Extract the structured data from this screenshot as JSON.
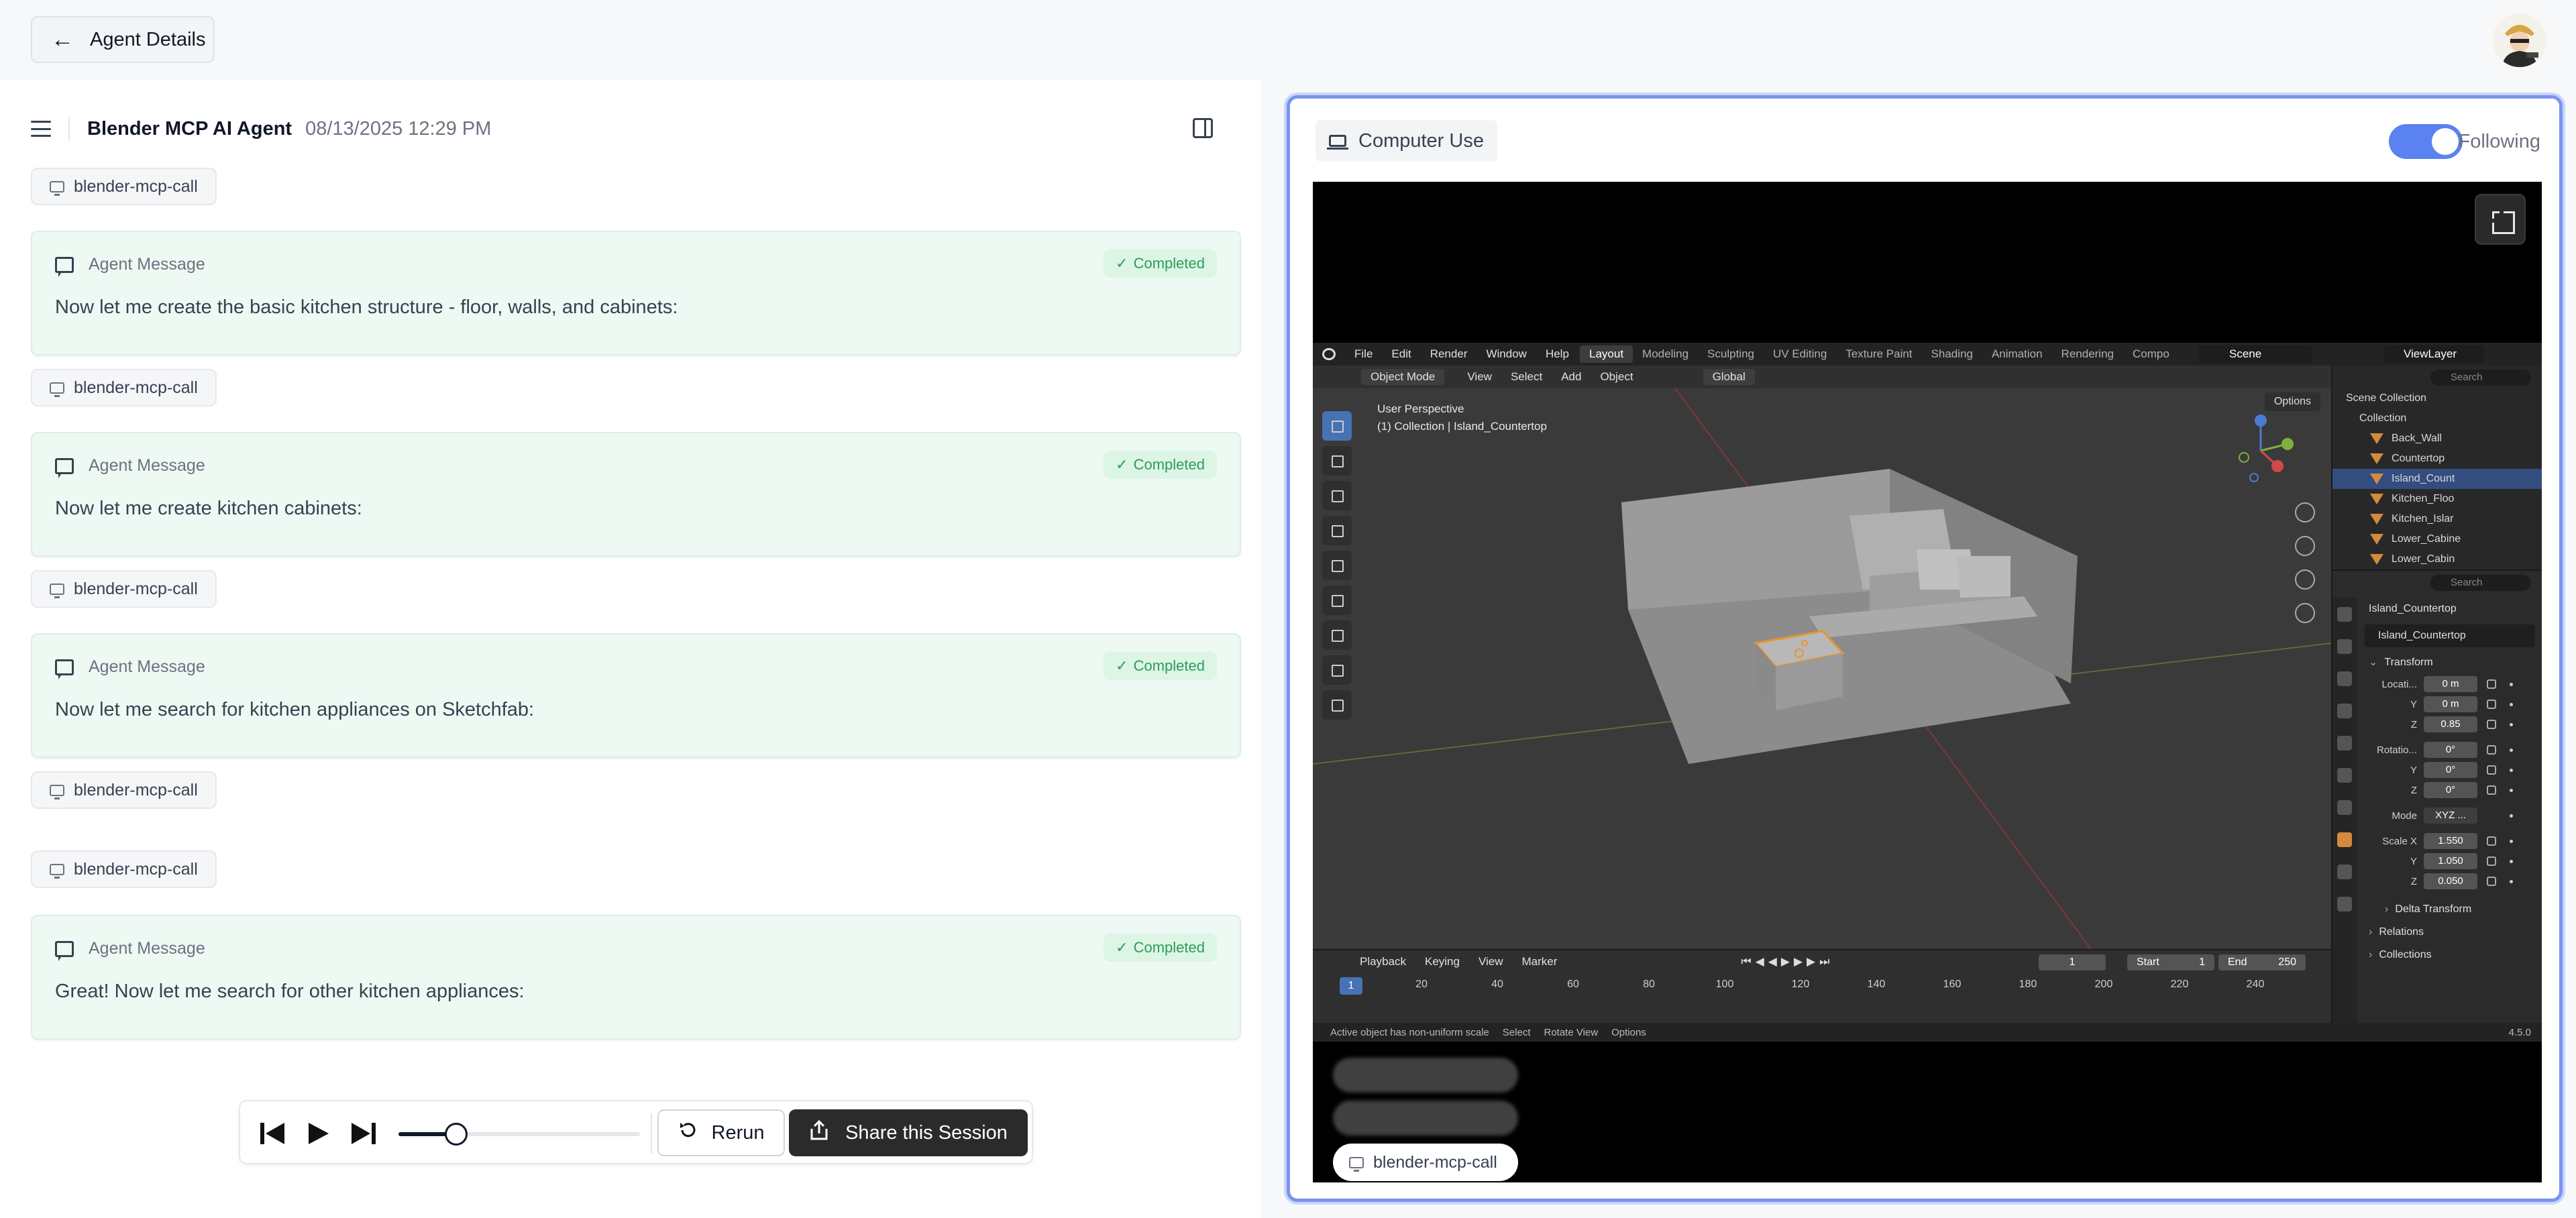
{
  "header": {
    "back_label": "Agent Details"
  },
  "left": {
    "agent_name": "Blender MCP AI Agent",
    "agent_datetime": "08/13/2025 12:29 PM",
    "feed": [
      {
        "type": "chip",
        "label": "blender-mcp-call"
      },
      {
        "type": "message",
        "title": "Agent Message",
        "status": "Completed",
        "text": "Now let me create the basic kitchen structure - floor, walls, and cabinets:"
      },
      {
        "type": "chip",
        "label": "blender-mcp-call"
      },
      {
        "type": "message",
        "title": "Agent Message",
        "status": "Completed",
        "text": "Now let me create kitchen cabinets:"
      },
      {
        "type": "chip",
        "label": "blender-mcp-call"
      },
      {
        "type": "message",
        "title": "Agent Message",
        "status": "Completed",
        "text": "Now let me search for kitchen appliances on Sketchfab:"
      },
      {
        "type": "chip",
        "label": "blender-mcp-call"
      },
      {
        "type": "chip",
        "label": "blender-mcp-call"
      },
      {
        "type": "message",
        "title": "Agent Message",
        "status": "Completed",
        "text": "Great! Now let me search for other kitchen appliances:"
      }
    ]
  },
  "controls": {
    "rerun_label": "Rerun",
    "share_label": "Share this Session",
    "progress": 0.24
  },
  "right": {
    "tab_label": "Computer Use",
    "following_label": "Following",
    "following_on": true,
    "accent_color": "#5b82f1",
    "screen_chip_label": "blender-mcp-call"
  },
  "blender": {
    "menu": [
      "File",
      "Edit",
      "Render",
      "Window",
      "Help"
    ],
    "workspaces": [
      "Layout",
      "Modeling",
      "Sculpting",
      "UV Editing",
      "Texture Paint",
      "Shading",
      "Animation",
      "Rendering",
      "Compo"
    ],
    "active_workspace": "Layout",
    "scene": "Scene",
    "view_layer": "ViewLayer",
    "mode": "Object Mode",
    "vp_menu": [
      "View",
      "Select",
      "Add",
      "Object"
    ],
    "orientation": "Global",
    "options_label": "Options",
    "perspective": "User Perspective",
    "active_path": "(1) Collection | Island_Countertop",
    "outliner_search": "Search",
    "outliner": [
      {
        "label": "Scene Collection",
        "level": 0,
        "selected": false
      },
      {
        "label": "Collection",
        "level": 1,
        "selected": false
      },
      {
        "label": "Back_Wall",
        "level": 2,
        "selected": false
      },
      {
        "label": "Countertop",
        "level": 2,
        "selected": false
      },
      {
        "label": "Island_Count",
        "level": 2,
        "selected": true
      },
      {
        "label": "Kitchen_Floo",
        "level": 2,
        "selected": false
      },
      {
        "label": "Kitchen_Islar",
        "level": 2,
        "selected": false
      },
      {
        "label": "Lower_Cabine",
        "level": 2,
        "selected": false
      },
      {
        "label": "Lower_Cabin",
        "level": 2,
        "selected": false
      }
    ],
    "props_search": "Search",
    "object_name": "Island_Countertop",
    "object_data": "Island_Countertop",
    "transform_label": "Transform",
    "location_label": "Locati...",
    "location": [
      "0 m",
      "0 m",
      "0.85"
    ],
    "rotation_label": "Rotatio...",
    "rotation": [
      "0°",
      "0°",
      "0°"
    ],
    "mode_label": "Mode",
    "rot_mode": "XYZ ...",
    "scale_label": "Scale X",
    "scale": [
      "1.550",
      "1.050",
      "0.050"
    ],
    "axis_labels": [
      "Y",
      "Z"
    ],
    "sections": [
      "Delta Transform",
      "Relations",
      "Collections"
    ],
    "timeline_menu": [
      "Playback",
      "Keying",
      "View",
      "Marker"
    ],
    "current_frame": "1",
    "start_label": "Start",
    "start": "1",
    "end_label": "End",
    "end": "250",
    "ruler": [
      "1",
      "20",
      "40",
      "60",
      "80",
      "100",
      "120",
      "140",
      "160",
      "180",
      "200",
      "220",
      "240"
    ],
    "status": [
      "Active object has non-uniform scale",
      "Select",
      "Rotate View",
      "Options"
    ],
    "version": "4.5.0"
  }
}
